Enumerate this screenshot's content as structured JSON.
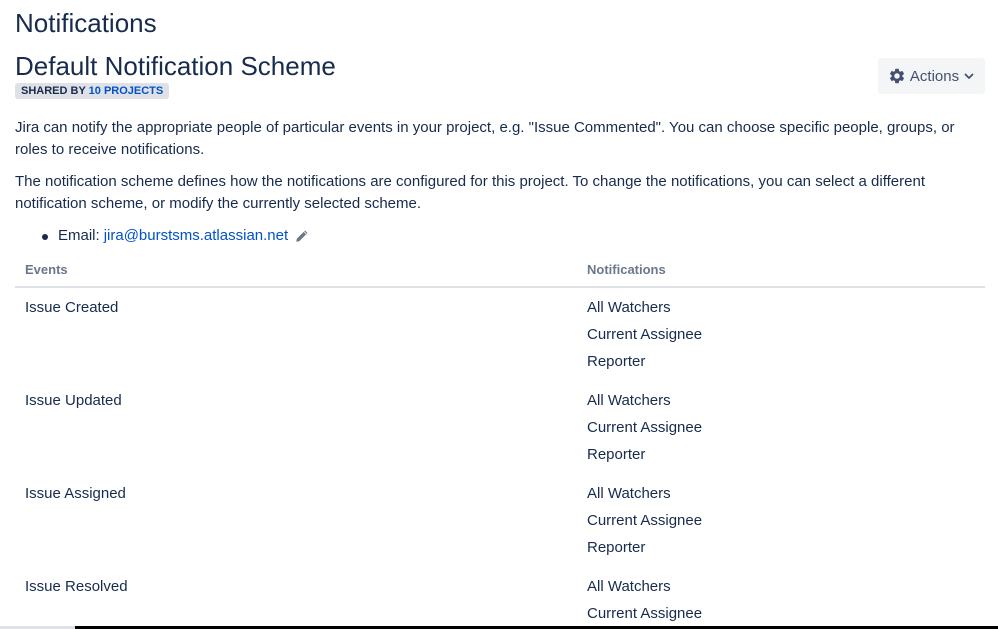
{
  "page": {
    "heading": "Notifications"
  },
  "scheme": {
    "title": "Default Notification Scheme",
    "shared_by_label": "SHARED BY",
    "shared_projects_link": "10 PROJECTS"
  },
  "actions": {
    "label": "Actions",
    "icon": "gear-icon",
    "dropdown_icon": "chevron-down-icon"
  },
  "description": {
    "paragraph_1": "Jira can notify the appropriate people of particular events in your project, e.g. \"Issue Commented\". You can choose specific people, groups, or roles to receive notifications.",
    "paragraph_2": "The notification scheme defines how the notifications are configured for this project. To change the notifications, you can select a different notification scheme, or modify the currently selected scheme."
  },
  "email": {
    "label": "Email:",
    "address": "jira@burstsms.atlassian.net",
    "edit_icon": "pencil-icon"
  },
  "table": {
    "headers": {
      "events": "Events",
      "notifications": "Notifications"
    },
    "rows": [
      {
        "event": "Issue Created",
        "notifications": [
          "All Watchers",
          "Current Assignee",
          "Reporter"
        ]
      },
      {
        "event": "Issue Updated",
        "notifications": [
          "All Watchers",
          "Current Assignee",
          "Reporter"
        ]
      },
      {
        "event": "Issue Assigned",
        "notifications": [
          "All Watchers",
          "Current Assignee",
          "Reporter"
        ]
      },
      {
        "event": "Issue Resolved",
        "notifications": [
          "All Watchers",
          "Current Assignee"
        ]
      }
    ]
  },
  "colors": {
    "text": "#172b4d",
    "link": "#0052cc",
    "muted": "#6b778c",
    "badge_bg": "#dfe1e6",
    "button_bg": "#f4f5f7"
  }
}
